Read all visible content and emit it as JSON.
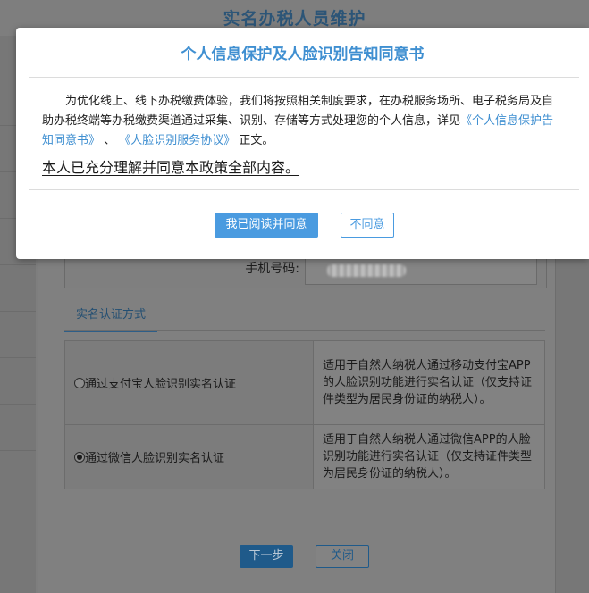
{
  "page": {
    "title": "实名办税人员维护"
  },
  "form": {
    "phone_label": "手机号码:",
    "auth_section_title": "实名认证方式",
    "options": [
      {
        "label": "通过支付宝人脸识别实名认证",
        "selected": false,
        "description": "适用于自然人纳税人通过移动支付宝APP的人脸识别功能进行实名认证（仅支持证件类型为居民身份证的纳税人）。"
      },
      {
        "label": "通过微信人脸识别实名认证",
        "selected": true,
        "description": "适用于自然人纳税人通过微信APP的人脸识别功能进行实名认证（仅支持证件类型为居民身份证的纳税人）。"
      }
    ],
    "next_label": "下一步",
    "close_label": "关闭"
  },
  "modal": {
    "title": "个人信息保护及人脸识别告知同意书",
    "body_part1": "为优化线上、线下办税缴费体验，我们将按照相关制度要求，在办税服务场所、电子税务局及自助办税终端等办税缴费渠道通过采集、识别、存储等方式处理您的个人信息，详见",
    "link1": "《个人信息保护告知同意书》",
    "separator": " 、 ",
    "link2": "《人脸识别服务协议》",
    "body_part2": " 正文。",
    "consent_text": "本人已充分理解并同意本政策全部内容。",
    "agree_label": "我已阅读并同意",
    "disagree_label": "不同意"
  },
  "colors": {
    "accent": "#4a9be0",
    "title_blue": "#3f8fd1",
    "dark_blue": "#1f5a8a"
  }
}
